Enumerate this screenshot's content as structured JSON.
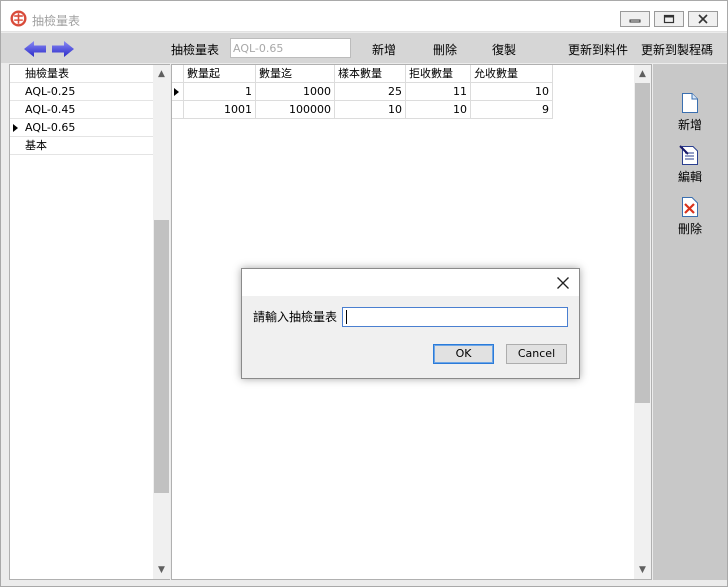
{
  "window": {
    "title": "抽檢量表"
  },
  "toolbar": {
    "table_label": "抽檢量表",
    "table_value": "AQL-0.65",
    "new_label": "新增",
    "delete_label": "刪除",
    "copy_label": "復製",
    "update_material_label": "更新到料件",
    "update_process_label": "更新到製程碼"
  },
  "left_list": {
    "header": "抽檢量表",
    "items": [
      "AQL-0.25",
      "AQL-0.45",
      "AQL-0.65",
      "基本"
    ],
    "selected_item": "AQL-0.65"
  },
  "grid": {
    "columns": [
      "數量起",
      "數量迄",
      "樣本數量",
      "拒收數量",
      "允收數量"
    ],
    "rows": [
      [
        "1",
        "1000",
        "25",
        "11",
        "10"
      ],
      [
        "1001",
        "100000",
        "10",
        "10",
        "9"
      ]
    ]
  },
  "side_actions": {
    "new_label": "新增",
    "edit_label": "編輯",
    "delete_label": "刪除"
  },
  "dialog": {
    "label": "請輸入抽檢量表",
    "input_value": "",
    "ok_label": "OK",
    "cancel_label": "Cancel"
  },
  "icons": {
    "app": "app-logo-icon",
    "prev": "arrow-left-icon",
    "next": "arrow-right-icon",
    "new": "new-document-icon",
    "edit": "edit-document-icon",
    "delete": "delete-document-icon"
  },
  "colors": {
    "toolbar_bg": "#d6d6d6",
    "arrow_fill": "#3b3bd6",
    "right_panel_bg": "#c8c8c8",
    "dialog_focus_border": "#4a7fd0"
  }
}
